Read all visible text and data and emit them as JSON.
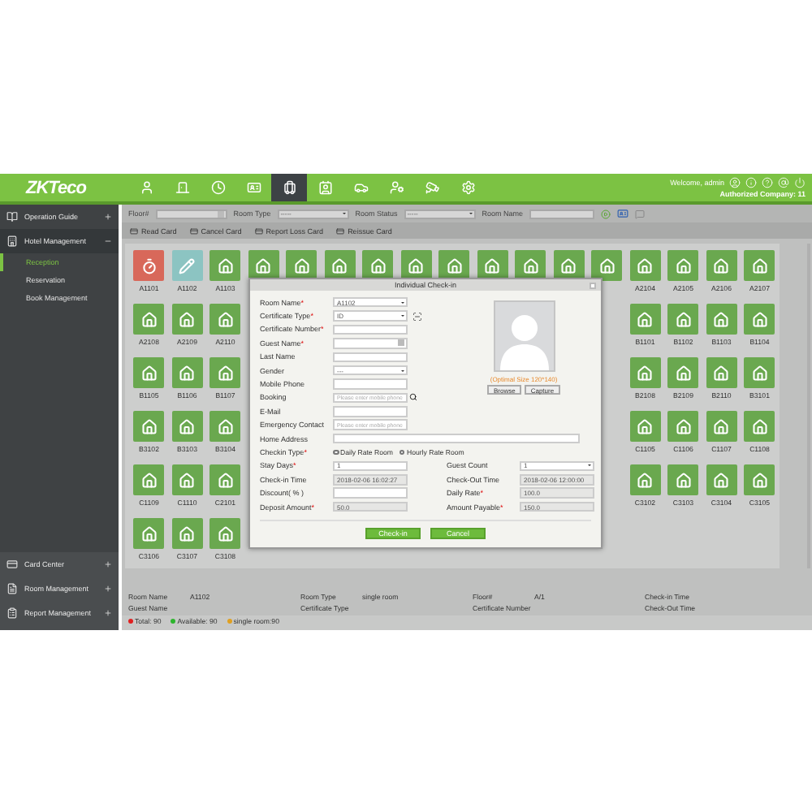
{
  "header": {
    "logo": "ZKTeco",
    "modules": [
      {
        "selected": false
      },
      {
        "selected": false
      },
      {
        "selected": false
      },
      {
        "selected": false
      },
      {
        "selected": true
      },
      {
        "selected": false
      },
      {
        "selected": false
      },
      {
        "selected": false
      },
      {
        "selected": false
      },
      {
        "selected": false
      }
    ],
    "welcome": "Welcome, admin",
    "company": "Authorized Company: 11"
  },
  "sidebar": {
    "sections": [
      {
        "label": "Operation Guide",
        "expanded": false
      },
      {
        "label": "Hotel Management",
        "expanded": true,
        "children": [
          {
            "label": "Reception",
            "selected": true
          },
          {
            "label": "Reservation",
            "selected": false
          },
          {
            "label": "Book Management",
            "selected": false
          }
        ]
      }
    ],
    "bottom": [
      {
        "label": "Card Center"
      },
      {
        "label": "Room Management"
      },
      {
        "label": "Report Management"
      }
    ]
  },
  "filters": [
    {
      "label": "Floor#",
      "kind": "picker"
    },
    {
      "label": "Room Type",
      "kind": "select",
      "value": "-----"
    },
    {
      "label": "Room Status",
      "kind": "select",
      "value": "-----"
    },
    {
      "label": "Room Name",
      "kind": "text"
    }
  ],
  "toolbar": [
    "Read Card",
    "Cancel Card",
    "Report Loss Card",
    "Reissue Card"
  ],
  "room_rows": [
    {
      "left": [
        {
          "label": "A1101",
          "kind": "occupied"
        },
        {
          "label": "A1102",
          "kind": "selected"
        },
        {
          "label": "A1103",
          "kind": "available"
        },
        {
          "kind": "available"
        },
        {
          "kind": "available"
        },
        {
          "kind": "available"
        },
        {
          "kind": "available"
        },
        {
          "kind": "available"
        },
        {
          "kind": "available"
        },
        {
          "kind": "available"
        },
        {
          "kind": "available"
        },
        {
          "kind": "available"
        },
        {
          "kind": "available"
        }
      ],
      "right": [
        {
          "label": "A2104",
          "kind": "available"
        },
        {
          "label": "A2105",
          "kind": "available"
        },
        {
          "label": "A2106",
          "kind": "available"
        },
        {
          "label": "A2107",
          "kind": "available"
        }
      ]
    },
    {
      "left": [
        {
          "label": "A2108",
          "kind": "available"
        },
        {
          "label": "A2109",
          "kind": "available"
        },
        {
          "label": "A2110",
          "kind": "available"
        }
      ],
      "right": [
        {
          "label": "B1101",
          "kind": "available"
        },
        {
          "label": "B1102",
          "kind": "available"
        },
        {
          "label": "B1103",
          "kind": "available"
        },
        {
          "label": "B1104",
          "kind": "available"
        }
      ]
    },
    {
      "left": [
        {
          "label": "B1105",
          "kind": "available"
        },
        {
          "label": "B1106",
          "kind": "available"
        },
        {
          "label": "B1107",
          "kind": "available"
        }
      ],
      "right": [
        {
          "label": "B2108",
          "kind": "available"
        },
        {
          "label": "B2109",
          "kind": "available"
        },
        {
          "label": "B2110",
          "kind": "available"
        },
        {
          "label": "B3101",
          "kind": "available"
        }
      ]
    },
    {
      "left": [
        {
          "label": "B3102",
          "kind": "available"
        },
        {
          "label": "B3103",
          "kind": "available"
        },
        {
          "label": "B3104",
          "kind": "available"
        }
      ],
      "right": [
        {
          "label": "C1105",
          "kind": "available"
        },
        {
          "label": "C1106",
          "kind": "available"
        },
        {
          "label": "C1107",
          "kind": "available"
        },
        {
          "label": "C1108",
          "kind": "available"
        }
      ]
    },
    {
      "left": [
        {
          "label": "C1109",
          "kind": "available"
        },
        {
          "label": "C1110",
          "kind": "available"
        },
        {
          "label": "C2101",
          "kind": "available"
        }
      ],
      "right": [
        {
          "label": "C3102",
          "kind": "available"
        },
        {
          "label": "C3103",
          "kind": "available"
        },
        {
          "label": "C3104",
          "kind": "available"
        },
        {
          "label": "C3105",
          "kind": "available"
        }
      ]
    },
    {
      "left": [
        {
          "label": "C3106",
          "kind": "available"
        },
        {
          "label": "C3107",
          "kind": "available"
        },
        {
          "label": "C3108",
          "kind": "available"
        }
      ],
      "right": []
    }
  ],
  "dialog": {
    "title": "Individual Check-in",
    "fields": [
      {
        "label": "Room Name",
        "mark": "*",
        "kind": "select",
        "value": "A1102"
      },
      {
        "label": "Certificate Type",
        "mark": "*",
        "kind": "select_scan",
        "value": "ID"
      },
      {
        "label": "Certificate Number",
        "mark": "*",
        "kind": "text"
      },
      {
        "label": "Guest Name",
        "mark": "*",
        "kind": "lookup"
      },
      {
        "label": "Last Name",
        "kind": "text"
      },
      {
        "label": "Gender",
        "kind": "select",
        "value": "---"
      },
      {
        "label": "Mobile Phone",
        "kind": "text"
      },
      {
        "label": "Booking",
        "kind": "search",
        "placeholder": "Please enter mobile phone"
      },
      {
        "label": "E-Mail",
        "kind": "text"
      },
      {
        "label": "Emergency Contact",
        "kind": "text",
        "placeholder": "Please enter mobile phone"
      }
    ],
    "photo": {
      "hint": "(Optimal Size 120*140)",
      "buttons": [
        "Browse",
        "Capture"
      ]
    },
    "address": {
      "label": "Home Address"
    },
    "checkin_type": {
      "label": "Checkin Type",
      "mark": "*",
      "options": [
        {
          "label": "Daily Rate Room",
          "selected": true
        },
        {
          "label": "Hourly Rate Room",
          "selected": false
        }
      ]
    },
    "pairs": [
      {
        "label": "Stay Days",
        "mark": "*",
        "kind": "text",
        "value": "1"
      },
      {
        "label": "Guest Count",
        "kind": "select",
        "value": "1"
      },
      {
        "label": "Check-in Time",
        "kind": "readonly",
        "value": "2018-02-06 16:02:27"
      },
      {
        "label": "Check-Out Time",
        "kind": "readonly",
        "value": "2018-02-06 12:00:00"
      },
      {
        "label": "Discount( % )",
        "kind": "text"
      },
      {
        "label": "Daily Rate",
        "mark": "*",
        "kind": "readonly",
        "value": "100.0"
      },
      {
        "label": "Deposit Amount",
        "mark": "*",
        "kind": "readonly",
        "value": "50.0"
      },
      {
        "label": "Amount Payable",
        "mark": "*",
        "kind": "readonly",
        "value": "150.0"
      }
    ],
    "actions": [
      "Check-in",
      "Cancel"
    ]
  },
  "info": [
    {
      "label": "Room Name",
      "value": "A1102"
    },
    {
      "label": "Room Type",
      "value": "single room"
    },
    {
      "label": "Floor#",
      "value": "A/1"
    },
    {
      "label": "Check-in Time"
    },
    {
      "label": "Guest Name"
    },
    {
      "label": "Certificate Type"
    },
    {
      "label": "Certificate Number"
    },
    {
      "label": "Check-Out Time"
    }
  ],
  "legend": [
    {
      "label": "Total: 90",
      "color": "#e02020"
    },
    {
      "label": "Available: 90",
      "color": "#2db52d"
    },
    {
      "label": "single room:90",
      "color": "#e0a020"
    }
  ]
}
